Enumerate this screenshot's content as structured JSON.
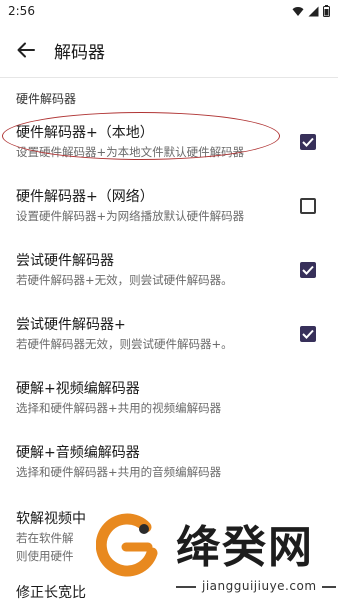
{
  "status": {
    "time": "2:56"
  },
  "appbar": {
    "title": "解码器"
  },
  "section": {
    "header": "硬件解码器"
  },
  "rows": [
    {
      "title": "硬件解码器+（本地）",
      "subtitle": "设置硬件解码器+为本地文件默认硬件解码器",
      "checked": true
    },
    {
      "title": "硬件解码器+（网络）",
      "subtitle": "设置硬件解码器+为网络播放默认硬件解码器",
      "checked": false
    },
    {
      "title": "尝试硬件解码器",
      "subtitle": "若硬件解码器+无效，则尝试硬件解码器。",
      "checked": true
    },
    {
      "title": "尝试硬件解码器+",
      "subtitle": "若硬件解码器无效，则尝试硬件解码器+。",
      "checked": true
    },
    {
      "title": "硬解+视频编解码器",
      "subtitle": "选择和硬件解码器+共用的视频编解码器"
    },
    {
      "title": "硬解+音频编解码器",
      "subtitle": "选择和硬件解码器+共用的音频编解码器"
    },
    {
      "title": "软解视频中",
      "subtitle": "若在软件解",
      "subtitle2": "则使用硬件"
    },
    {
      "title": "修正长宽比"
    }
  ],
  "watermark": {
    "text": "绛癸网",
    "url": "jiangguijiuye.com"
  },
  "colors": {
    "checkbox_fill": "#37305a",
    "highlight": "#b03535",
    "watermark_orange": "#e8891f"
  }
}
